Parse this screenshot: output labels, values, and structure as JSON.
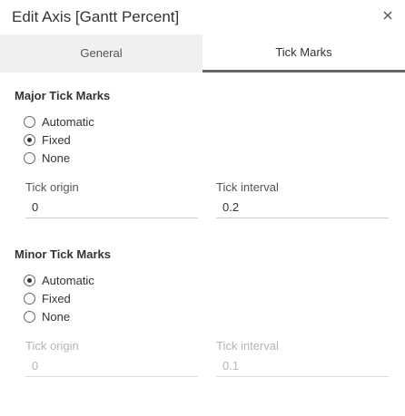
{
  "dialog": {
    "title": "Edit Axis [Gantt Percent]",
    "close_icon": "close-icon"
  },
  "tabs": [
    {
      "label": "General",
      "active": false
    },
    {
      "label": "Tick Marks",
      "active": true
    }
  ],
  "major": {
    "title": "Major Tick Marks",
    "options": [
      {
        "label": "Automatic",
        "checked": false
      },
      {
        "label": "Fixed",
        "checked": true
      },
      {
        "label": "None",
        "checked": false
      }
    ],
    "origin_label": "Tick origin",
    "origin_value": "0",
    "interval_label": "Tick interval",
    "interval_value": "0.2"
  },
  "minor": {
    "title": "Minor Tick Marks",
    "options": [
      {
        "label": "Automatic",
        "checked": true
      },
      {
        "label": "Fixed",
        "checked": false
      },
      {
        "label": "None",
        "checked": false
      }
    ],
    "origin_label": "Tick origin",
    "origin_value": "0",
    "interval_label": "Tick interval",
    "interval_value": "0.1"
  }
}
